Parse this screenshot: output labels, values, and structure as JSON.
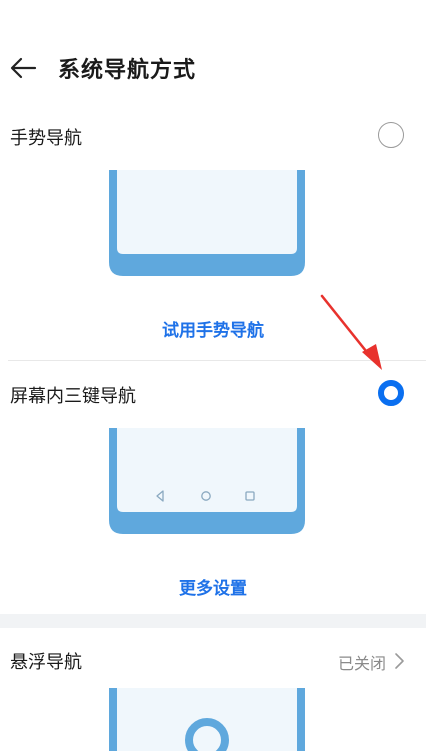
{
  "header": {
    "title": "系统导航方式",
    "back_icon": "back-arrow-icon"
  },
  "options": [
    {
      "label": "手势导航",
      "selected": false,
      "action_label": "试用手势导航"
    },
    {
      "label": "屏幕内三键导航",
      "selected": true,
      "action_label": "更多设置"
    }
  ],
  "floating_nav": {
    "label": "悬浮导航",
    "status": "已关闭",
    "chevron_icon": "chevron-right-icon"
  },
  "colors": {
    "accent": "#1f72e8",
    "radio_selected": "#0a6ff0",
    "phone_frame": "#5fa8dd",
    "annotation": "#e8322d"
  }
}
